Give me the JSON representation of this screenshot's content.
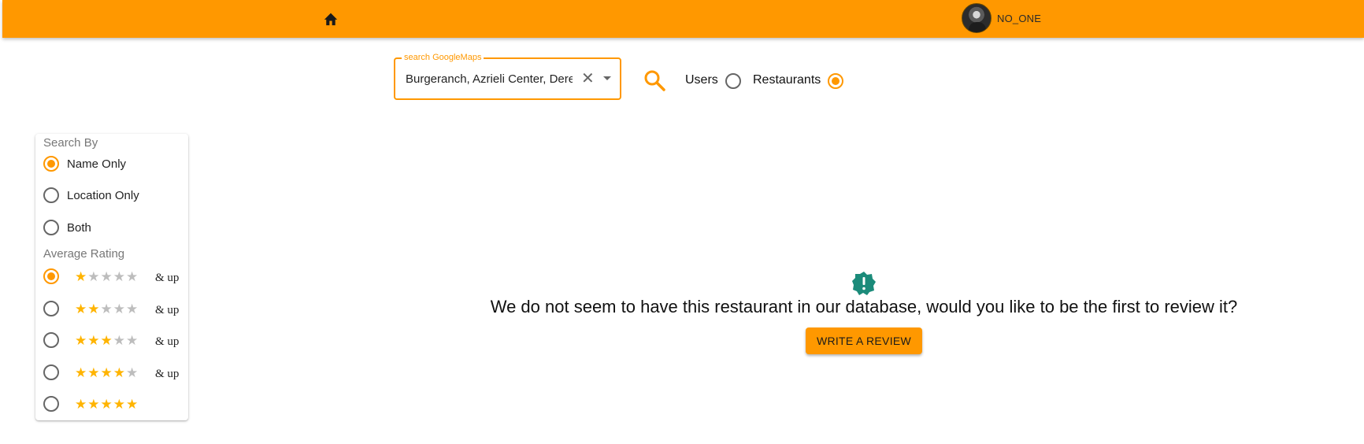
{
  "colors": {
    "accent": "#ff9800",
    "star": "#ffb400",
    "star_empty": "#bdbdbd",
    "notice_icon": "#1b8b7a"
  },
  "header": {
    "home_icon": "home-icon",
    "user": {
      "name": "NO_ONE",
      "avatar": "avatar"
    }
  },
  "search": {
    "legend": "search GoogleMaps",
    "value": "Burgeranch, Azrieli Center, Derech Menachem Begin, Tel Aviv-Yafo, Israel",
    "clear_icon": "close-icon",
    "dropdown_icon": "arrow-drop-down-icon",
    "go_icon": "search-icon"
  },
  "mode": {
    "options": [
      {
        "label": "Users",
        "selected": false
      },
      {
        "label": "Restaurants",
        "selected": true
      }
    ]
  },
  "filters": {
    "search_by": {
      "title": "Search By",
      "options": [
        {
          "label": "Name Only",
          "selected": true
        },
        {
          "label": "Location Only",
          "selected": false
        },
        {
          "label": "Both",
          "selected": false
        }
      ]
    },
    "rating": {
      "title": "Average Rating",
      "options": [
        {
          "stars": 1,
          "suffix": "& up",
          "selected": true
        },
        {
          "stars": 2,
          "suffix": "& up",
          "selected": false
        },
        {
          "stars": 3,
          "suffix": "& up",
          "selected": false
        },
        {
          "stars": 4,
          "suffix": "& up",
          "selected": false
        },
        {
          "stars": 5,
          "suffix": "",
          "selected": false
        }
      ]
    }
  },
  "notice": {
    "icon": "alert-badge-icon",
    "message": "We do not seem to have this restaurant in our database, would you like to be the first to review it?",
    "button_label": "WRITE A REVIEW"
  }
}
